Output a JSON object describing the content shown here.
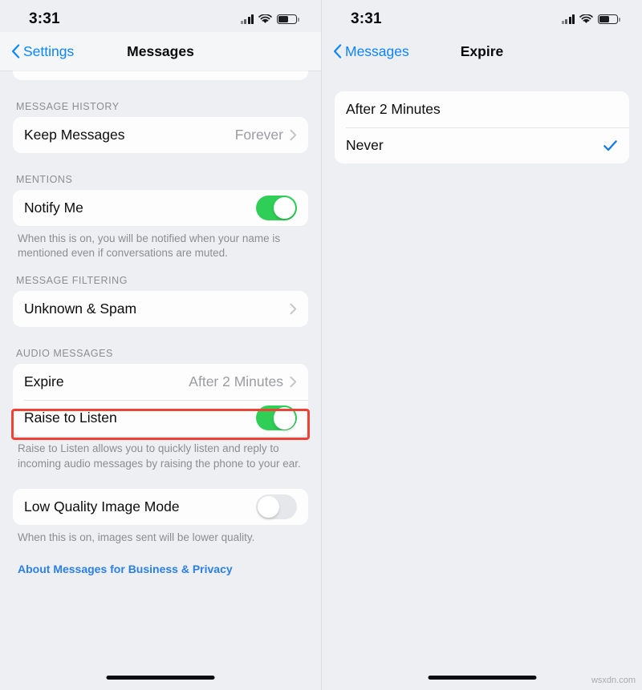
{
  "watermark": "wsxdn.com",
  "highlight_color": "#ef4136",
  "accent_color": "#0a84ff",
  "toggle_on_color": "#2fce56",
  "left_screen": {
    "status": {
      "time": "3:31",
      "signal_icon": "cellular-signal-icon",
      "wifi_icon": "wifi-icon",
      "battery_icon": "battery-icon"
    },
    "nav": {
      "back_label": "Settings",
      "back_icon": "chevron-left-icon",
      "title": "Messages"
    },
    "sections": [
      {
        "header": "MESSAGE HISTORY",
        "rows": [
          {
            "label": "Keep Messages",
            "value": "Forever",
            "accessory": "chevron-right-icon"
          }
        ],
        "footnote": ""
      },
      {
        "header": "MENTIONS",
        "rows": [
          {
            "label": "Notify Me",
            "accessory": "toggle-on"
          }
        ],
        "footnote": "When this is on, you will be notified when your name is mentioned even if conversations are muted."
      },
      {
        "header": "MESSAGE FILTERING",
        "rows": [
          {
            "label": "Unknown & Spam",
            "value": "",
            "accessory": "chevron-right-icon"
          }
        ],
        "footnote": ""
      },
      {
        "header": "AUDIO MESSAGES",
        "rows": [
          {
            "label": "Expire",
            "value": "After 2 Minutes",
            "accessory": "chevron-right-icon"
          },
          {
            "label": "Raise to Listen",
            "accessory": "toggle-on"
          }
        ],
        "footnote": "Raise to Listen allows you to quickly listen and reply to incoming audio messages by raising the phone to your ear."
      },
      {
        "header": "",
        "rows": [
          {
            "label": "Low Quality Image Mode",
            "accessory": "toggle-off"
          }
        ],
        "footnote": "When this is on, images sent will be lower quality."
      }
    ],
    "link": "About Messages for Business & Privacy"
  },
  "right_screen": {
    "status": {
      "time": "3:31",
      "signal_icon": "cellular-signal-icon",
      "wifi_icon": "wifi-icon",
      "battery_icon": "battery-icon"
    },
    "nav": {
      "back_label": "Messages",
      "back_icon": "chevron-left-icon",
      "title": "Expire"
    },
    "options": [
      {
        "label": "After 2 Minutes",
        "selected": false
      },
      {
        "label": "Never",
        "selected": true
      }
    ]
  }
}
